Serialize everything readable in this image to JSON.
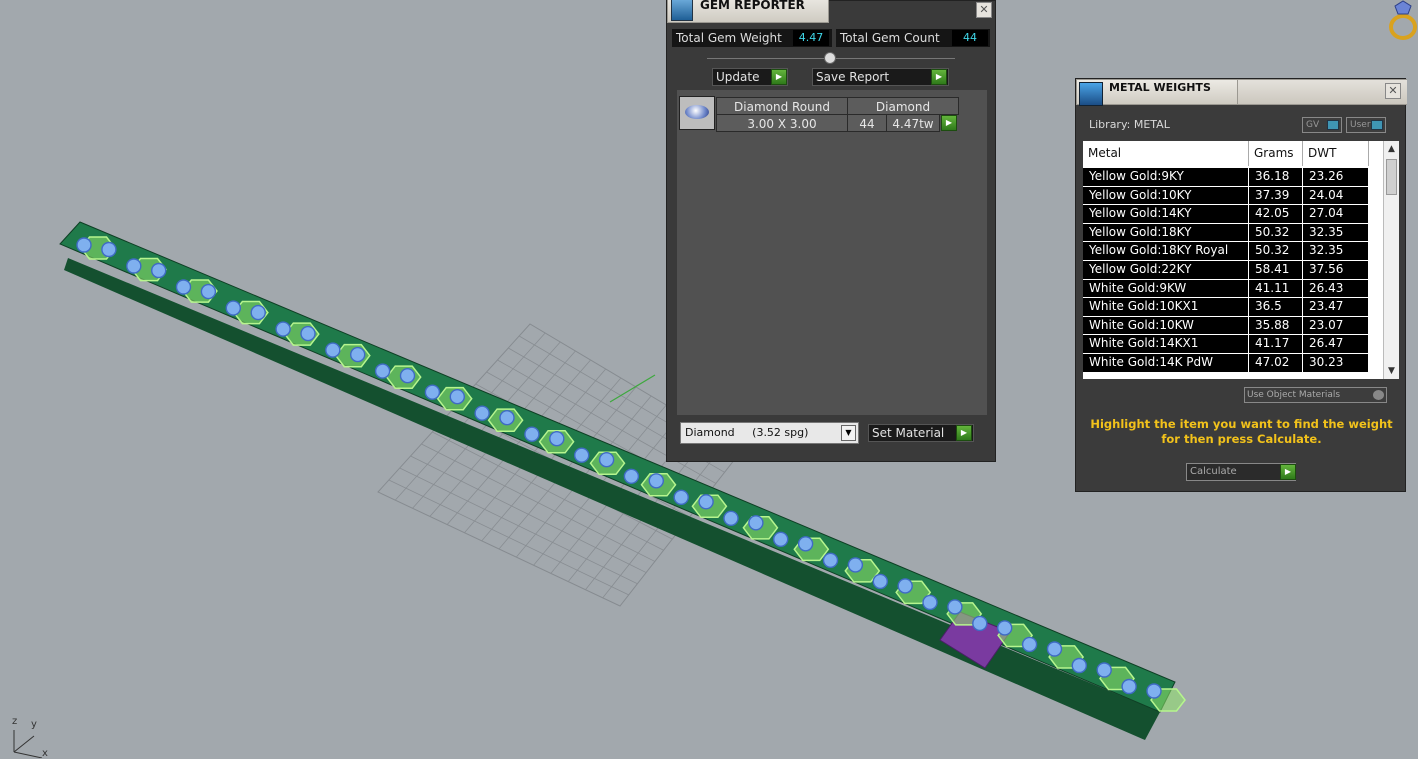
{
  "gem_reporter": {
    "title": "GEM REPORTER",
    "total_weight_label": "Total Gem Weight",
    "total_weight_value": "4.47",
    "total_count_label": "Total Gem Count",
    "total_count_value": "44",
    "update_label": "Update",
    "save_report_label": "Save Report",
    "gems": [
      {
        "shape": "Diamond Round",
        "size": "3.00 X 3.00",
        "material": "Diamond",
        "count": "44",
        "weight": "4.47tw"
      }
    ],
    "material_select": "Diamond     (3.52 spg)",
    "set_material_label": "Set Material"
  },
  "metal_weights": {
    "title": "METAL WEIGHTS",
    "library_label": "Library: METAL",
    "toggle_gv": "GV",
    "toggle_user": "User",
    "columns": [
      "Metal",
      "Grams",
      "DWT"
    ],
    "rows": [
      {
        "metal": "Yellow Gold:9KY",
        "grams": "36.18",
        "dwt": "23.26"
      },
      {
        "metal": "Yellow Gold:10KY",
        "grams": "37.39",
        "dwt": "24.04"
      },
      {
        "metal": "Yellow Gold:14KY",
        "grams": "42.05",
        "dwt": "27.04"
      },
      {
        "metal": "Yellow Gold:18KY",
        "grams": "50.32",
        "dwt": "32.35"
      },
      {
        "metal": "Yellow Gold:18KY Royal",
        "grams": "50.32",
        "dwt": "32.35"
      },
      {
        "metal": "Yellow Gold:22KY",
        "grams": "58.41",
        "dwt": "37.56"
      },
      {
        "metal": "White Gold:9KW",
        "grams": "41.11",
        "dwt": "26.43"
      },
      {
        "metal": "White Gold:10KX1",
        "grams": "36.5",
        "dwt": "23.47"
      },
      {
        "metal": "White Gold:10KW",
        "grams": "35.88",
        "dwt": "23.07"
      },
      {
        "metal": "White Gold:14KX1",
        "grams": "41.17",
        "dwt": "26.47"
      },
      {
        "metal": "White Gold:14K PdW",
        "grams": "47.02",
        "dwt": "30.23"
      }
    ],
    "use_object_materials_label": "Use Object Materials",
    "hint_line1": "Highlight the item you want to find the weight",
    "hint_line2": "for then press Calculate.",
    "calculate_label": "Calculate"
  },
  "viewport": {
    "axis_z": "z",
    "axis_y": "y",
    "axis_x": "x",
    "band_fill": "#1f7a4a",
    "highlight_fill": "#8fe36a",
    "selected_fill": "#7a3aa0",
    "gem_fill": "#7fb0ef"
  }
}
